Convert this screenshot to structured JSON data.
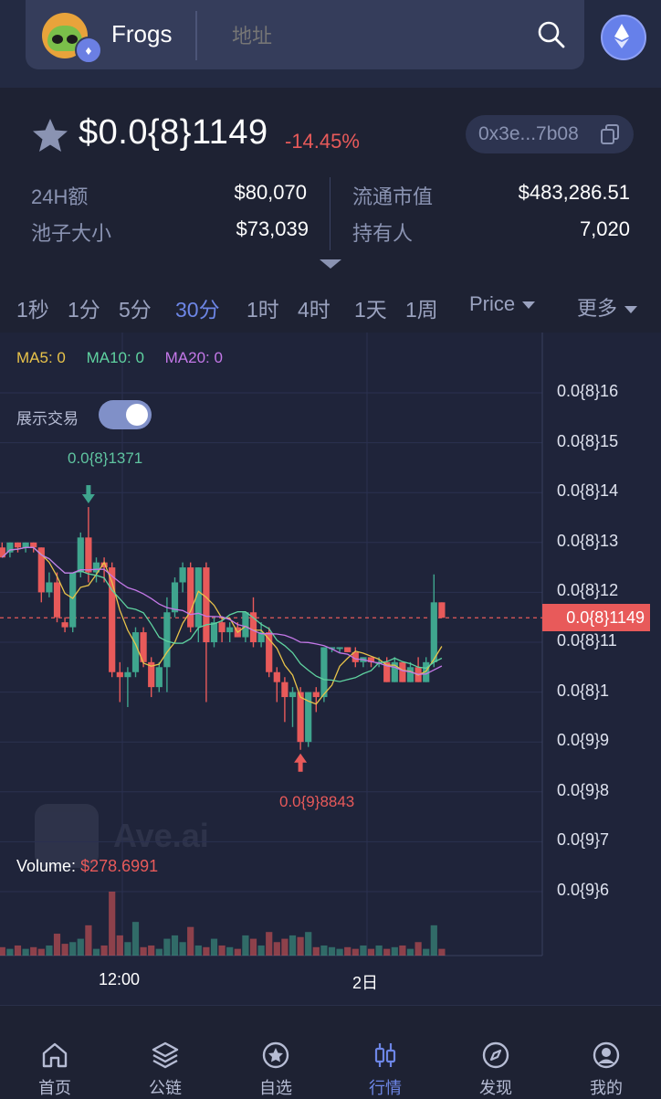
{
  "header": {
    "token_name": "Frogs",
    "address_placeholder": "地址",
    "avatar_icon": "frog-avatar",
    "chain_icon": "ethereum-icon",
    "search_icon": "search-icon",
    "network_icon": "ethereum-icon"
  },
  "price": {
    "value": "$0.0{8}1149",
    "change": "-14.45%",
    "change_color": "#e85a5a",
    "contract_short": "0x3e...7b08"
  },
  "stats": {
    "vol_label": "24H额",
    "vol_value": "$80,070",
    "mcap_label": "流通市值",
    "mcap_value": "$483,286.51",
    "pool_label": "池子大小",
    "pool_value": "$73,039",
    "holders_label": "持有人",
    "holders_value": "7,020"
  },
  "timeframes": {
    "items": [
      "1秒",
      "1分",
      "5分",
      "30分",
      "1时",
      "4时",
      "1天",
      "1周"
    ],
    "active": "30分",
    "price_dropdown": "Price",
    "more_dropdown": "更多"
  },
  "chart": {
    "ma5": "MA5: 0",
    "ma10": "MA10: 0",
    "ma20": "MA20: 0",
    "ma5_color": "#e8c34a",
    "ma10_color": "#5fd3a0",
    "ma20_color": "#c478e8",
    "trade_toggle_label": "展示交易",
    "trade_toggle_on": true,
    "volume_label": "Volume:",
    "volume_value": "$278.6991",
    "watermark": "Ave.ai",
    "high_annotation": "0.0{8}1371",
    "low_annotation": "0.0{9}8843",
    "current_price_tag": "0.0{8}1149",
    "up_color": "#3fa58e",
    "down_color": "#e85a5a"
  },
  "chart_data": {
    "type": "candlestick",
    "title": "",
    "y_tick_labels": [
      "0.0{8}16",
      "0.0{8}15",
      "0.0{8}14",
      "0.0{8}13",
      "0.0{8}12",
      "0.0{8}11",
      "0.0{8}1",
      "0.0{9}9",
      "0.0{9}8",
      "0.0{9}7",
      "0.0{9}6"
    ],
    "y_ticks": [
      1.6e-09,
      1.5e-09,
      1.4e-09,
      1.3e-09,
      1.2e-09,
      1.1e-09,
      1e-09,
      9e-10,
      8e-10,
      7e-10,
      6e-10
    ],
    "ylim": [
      5.45e-10,
      1.655e-09
    ],
    "x_tick_labels": [
      "12:00",
      "2日"
    ],
    "grid": true,
    "current_price": 1.149e-09,
    "candles": [
      {
        "o": 1.29e-09,
        "h": 1.3e-09,
        "l": 1.27e-09,
        "c": 1.27e-09
      },
      {
        "o": 1.28e-09,
        "h": 1.3e-09,
        "l": 1.27e-09,
        "c": 1.3e-09
      },
      {
        "o": 1.3e-09,
        "h": 1.3e-09,
        "l": 1.28e-09,
        "c": 1.29e-09
      },
      {
        "o": 1.29e-09,
        "h": 1.3e-09,
        "l": 1.28e-09,
        "c": 1.3e-09
      },
      {
        "o": 1.3e-09,
        "h": 1.3e-09,
        "l": 1.28e-09,
        "c": 1.29e-09
      },
      {
        "o": 1.29e-09,
        "h": 1.29e-09,
        "l": 1.18e-09,
        "c": 1.2e-09
      },
      {
        "o": 1.2e-09,
        "h": 1.24e-09,
        "l": 1.19e-09,
        "c": 1.22e-09
      },
      {
        "o": 1.22e-09,
        "h": 1.24e-09,
        "l": 1.14e-09,
        "c": 1.15e-09
      },
      {
        "o": 1.14e-09,
        "h": 1.15e-09,
        "l": 1.12e-09,
        "c": 1.13e-09
      },
      {
        "o": 1.13e-09,
        "h": 1.24e-09,
        "l": 1.12e-09,
        "c": 1.24e-09
      },
      {
        "o": 1.24e-09,
        "h": 1.32e-09,
        "l": 1.23e-09,
        "c": 1.31e-09
      },
      {
        "o": 1.31e-09,
        "h": 1.371e-09,
        "l": 1.22e-09,
        "c": 1.24e-09
      },
      {
        "o": 1.24e-09,
        "h": 1.27e-09,
        "l": 1.22e-09,
        "c": 1.26e-09
      },
      {
        "o": 1.26e-09,
        "h": 1.27e-09,
        "l": 1.22e-09,
        "c": 1.25e-09
      },
      {
        "o": 1.25e-09,
        "h": 1.26e-09,
        "l": 1.03e-09,
        "c": 1.04e-09
      },
      {
        "o": 1.04e-09,
        "h": 1.06e-09,
        "l": 9.8e-10,
        "c": 1.03e-09
      },
      {
        "o": 1.03e-09,
        "h": 1.05e-09,
        "l": 9.7e-10,
        "c": 1.04e-09
      },
      {
        "o": 1.04e-09,
        "h": 1.13e-09,
        "l": 1.03e-09,
        "c": 1.12e-09
      },
      {
        "o": 1.12e-09,
        "h": 1.13e-09,
        "l": 1.05e-09,
        "c": 1.06e-09
      },
      {
        "o": 1.06e-09,
        "h": 1.07e-09,
        "l": 9.9e-10,
        "c": 1.01e-09
      },
      {
        "o": 1.01e-09,
        "h": 1.06e-09,
        "l": 1e-09,
        "c": 1.05e-09
      },
      {
        "o": 1.05e-09,
        "h": 1.19e-09,
        "l": 1e-09,
        "c": 1.16e-09
      },
      {
        "o": 1.16e-09,
        "h": 1.23e-09,
        "l": 1.15e-09,
        "c": 1.22e-09
      },
      {
        "o": 1.22e-09,
        "h": 1.26e-09,
        "l": 1.2e-09,
        "c": 1.25e-09
      },
      {
        "o": 1.25e-09,
        "h": 1.26e-09,
        "l": 1.12e-09,
        "c": 1.13e-09
      },
      {
        "o": 1.13e-09,
        "h": 1.25e-09,
        "l": 1.1e-09,
        "c": 1.25e-09
      },
      {
        "o": 1.25e-09,
        "h": 1.26e-09,
        "l": 9.8e-10,
        "c": 1.1e-09
      },
      {
        "o": 1.1e-09,
        "h": 1.15e-09,
        "l": 1.09e-09,
        "c": 1.14e-09
      },
      {
        "o": 1.14e-09,
        "h": 1.15e-09,
        "l": 1.1e-09,
        "c": 1.12e-09
      },
      {
        "o": 1.12e-09,
        "h": 1.14e-09,
        "l": 1.1e-09,
        "c": 1.13e-09
      },
      {
        "o": 1.13e-09,
        "h": 1.14e-09,
        "l": 1.11e-09,
        "c": 1.11e-09
      },
      {
        "o": 1.11e-09,
        "h": 1.16e-09,
        "l": 1.1e-09,
        "c": 1.16e-09
      },
      {
        "o": 1.16e-09,
        "h": 1.19e-09,
        "l": 1.09e-09,
        "c": 1.1e-09
      },
      {
        "o": 1.1e-09,
        "h": 1.14e-09,
        "l": 1.09e-09,
        "c": 1.12e-09
      },
      {
        "o": 1.12e-09,
        "h": 1.13e-09,
        "l": 1.03e-09,
        "c": 1.04e-09
      },
      {
        "o": 1.04e-09,
        "h": 1.05e-09,
        "l": 9.8e-10,
        "c": 1.02e-09
      },
      {
        "o": 1.02e-09,
        "h": 1.03e-09,
        "l": 9.4e-10,
        "c": 9.9e-10
      },
      {
        "o": 9.9e-10,
        "h": 1.01e-09,
        "l": 9.3e-10,
        "c": 1e-09
      },
      {
        "o": 1e-09,
        "h": 1.01e-09,
        "l": 8.843e-10,
        "c": 9e-10
      },
      {
        "o": 9e-10,
        "h": 1e-09,
        "l": 8.9e-10,
        "c": 1e-09
      },
      {
        "o": 1e-09,
        "h": 1.01e-09,
        "l": 9.6e-10,
        "c": 9.9e-10
      },
      {
        "o": 9.9e-10,
        "h": 1.09e-09,
        "l": 9.8e-10,
        "c": 1.09e-09
      },
      {
        "o": 1.09e-09,
        "h": 1.09e-09,
        "l": 1.08e-09,
        "c": 1.09e-09
      },
      {
        "o": 1.09e-09,
        "h": 1.09e-09,
        "l": 1.08e-09,
        "c": 1.09e-09
      },
      {
        "o": 1.09e-09,
        "h": 1.09e-09,
        "l": 1.08e-09,
        "c": 1.08e-09
      },
      {
        "o": 1.08e-09,
        "h": 1.09e-09,
        "l": 1.05e-09,
        "c": 1.06e-09
      },
      {
        "o": 1.06e-09,
        "h": 1.07e-09,
        "l": 1.05e-09,
        "c": 1.07e-09
      },
      {
        "o": 1.07e-09,
        "h": 1.07e-09,
        "l": 1.05e-09,
        "c": 1.06e-09
      },
      {
        "o": 1.06e-09,
        "h": 1.07e-09,
        "l": 1.05e-09,
        "c": 1.06e-09
      },
      {
        "o": 1.06e-09,
        "h": 1.07e-09,
        "l": 1.02e-09,
        "c": 1.02e-09
      },
      {
        "o": 1.02e-09,
        "h": 1.07e-09,
        "l": 1.02e-09,
        "c": 1.06e-09
      },
      {
        "o": 1.06e-09,
        "h": 1.06e-09,
        "l": 1.02e-09,
        "c": 1.02e-09
      },
      {
        "o": 1.02e-09,
        "h": 1.06e-09,
        "l": 1.02e-09,
        "c": 1.05e-09
      },
      {
        "o": 1.05e-09,
        "h": 1.07e-09,
        "l": 1.02e-09,
        "c": 1.02e-09
      },
      {
        "o": 1.02e-09,
        "h": 1.07e-09,
        "l": 1.02e-09,
        "c": 1.06e-09
      },
      {
        "o": 1.06e-09,
        "h": 1.236e-09,
        "l": 1.05e-09,
        "c": 1.18e-09
      },
      {
        "o": 1.18e-09,
        "h": 1.18e-09,
        "l": 1.149e-09,
        "c": 1.149e-09
      }
    ],
    "volume": [
      0.25,
      0.2,
      0.3,
      0.2,
      0.25,
      0.2,
      0.3,
      0.65,
      0.35,
      0.4,
      0.5,
      0.9,
      0.2,
      0.3,
      1.9,
      0.6,
      0.4,
      1.0,
      0.25,
      0.3,
      0.2,
      0.5,
      0.6,
      0.4,
      0.85,
      0.3,
      0.25,
      0.5,
      0.3,
      0.25,
      0.2,
      0.6,
      0.5,
      0.3,
      0.7,
      0.4,
      0.5,
      0.6,
      0.55,
      0.7,
      0.25,
      0.3,
      0.25,
      0.2,
      0.25,
      0.2,
      0.3,
      0.2,
      0.3,
      0.2,
      0.25,
      0.3,
      0.2,
      0.4,
      0.2,
      0.9,
      0.2
    ]
  },
  "nav": {
    "items": [
      {
        "label": "首页",
        "icon": "home-icon"
      },
      {
        "label": "公链",
        "icon": "layers-icon"
      },
      {
        "label": "自选",
        "icon": "star-icon"
      },
      {
        "label": "行情",
        "icon": "candlestick-icon"
      },
      {
        "label": "发现",
        "icon": "compass-icon"
      },
      {
        "label": "我的",
        "icon": "user-icon"
      }
    ],
    "active_index": 3
  }
}
